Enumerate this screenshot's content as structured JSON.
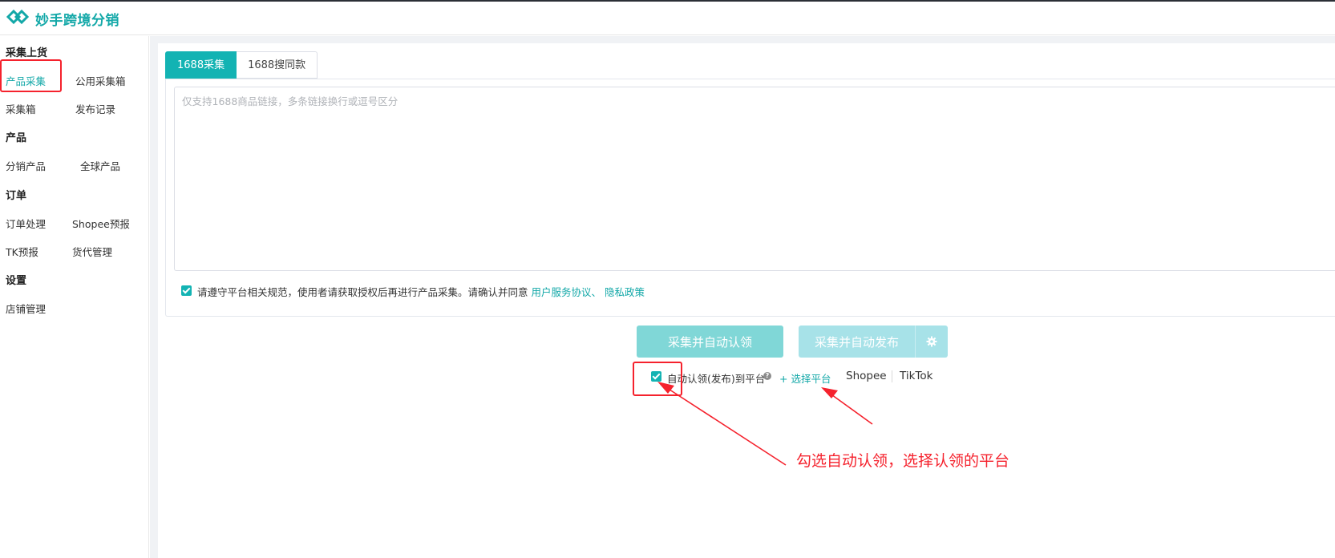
{
  "app": {
    "title": "妙手跨境分销",
    "brand_color": "#13a8a8"
  },
  "sidebar": {
    "groups": [
      {
        "title": "采集上货",
        "items": [
          "产品采集",
          "公用采集箱",
          "采集箱",
          "发布记录"
        ]
      },
      {
        "title": "产品",
        "items": [
          "分销产品",
          "全球产品"
        ]
      },
      {
        "title": "订单",
        "items": [
          "订单处理",
          "Shopee预报",
          "TK预报",
          "货代管理"
        ]
      },
      {
        "title": "设置",
        "items": [
          "店铺管理"
        ]
      }
    ],
    "active_item": "产品采集"
  },
  "tabs": [
    {
      "label": "1688采集",
      "active": true
    },
    {
      "label": "1688搜同款",
      "active": false
    }
  ],
  "input": {
    "placeholder": "仅支持1688商品链接，多条链接换行或逗号区分",
    "value": ""
  },
  "agreement": {
    "checked": true,
    "text": "请遵守平台相关规范，使用者请获取授权后再进行产品采集。请确认并同意",
    "link1": "用户服务协议",
    "separator": "、",
    "link2": "隐私政策"
  },
  "buttons": {
    "claim": "采集并自动认领",
    "publish": "采集并自动发布",
    "settings_icon": "gear-icon"
  },
  "auto_claim": {
    "checked": true,
    "label": "自动认领(发布)到平台",
    "help_icon": "?",
    "select_label": "+ 选择平台",
    "platforms": [
      "Shopee",
      "TikTok"
    ]
  },
  "annotation": {
    "text": "勾选自动认领，选择认领的平台",
    "color": "#f5222d"
  }
}
